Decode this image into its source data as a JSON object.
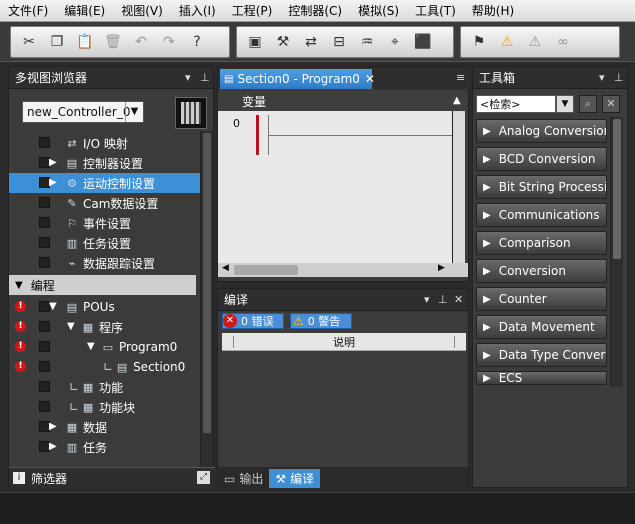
{
  "menu": [
    "文件(F)",
    "编辑(E)",
    "视图(V)",
    "插入(I)",
    "工程(P)",
    "控制器(C)",
    "模拟(S)",
    "工具(T)",
    "帮助(H)"
  ],
  "toolbar": {
    "icons": [
      "cut-icon",
      "copy-icon",
      "paste-icon",
      "delete-icon",
      "undo-icon",
      "redo-icon",
      "help-icon",
      "window-icon",
      "build-icon",
      "transfer-icon",
      "compare-icon",
      "monitor-icon",
      "find-icon",
      "error-icon",
      "verify-icon",
      "warning-icon",
      "warning-off-icon",
      "glasses-icon"
    ]
  },
  "left": {
    "title": "多视图浏览器",
    "controller": "new_Controller_0",
    "items": [
      {
        "label": "I/O 映射"
      },
      {
        "label": "控制器设置"
      },
      {
        "label": "运动控制设置"
      },
      {
        "label": "Cam数据设置"
      },
      {
        "label": "事件设置"
      },
      {
        "label": "任务设置"
      },
      {
        "label": "数据跟踪设置"
      },
      {
        "label": "编程"
      },
      {
        "label": "POUs"
      },
      {
        "label": "程序"
      },
      {
        "label": "Program0"
      },
      {
        "label": "Section0"
      },
      {
        "label": "功能"
      },
      {
        "label": "功能块"
      },
      {
        "label": "数据"
      },
      {
        "label": "任务"
      }
    ],
    "filter": "筛选器"
  },
  "editor": {
    "tab": "Section0 - Program0",
    "var_label": "变量",
    "rung": "0"
  },
  "build": {
    "title": "编译",
    "errors_label": "0 错误",
    "warnings_label": "0 警告",
    "col_desc": "说明",
    "tabs": [
      "输出",
      "编译"
    ]
  },
  "toolbox": {
    "title": "工具箱",
    "search": "<检索>",
    "items": [
      "Analog Conversion",
      "BCD Conversion",
      "Bit String Processin",
      "Communications",
      "Comparison",
      "Conversion",
      "Counter",
      "Data Movement",
      "Data Type Conversi",
      "ECS"
    ]
  }
}
